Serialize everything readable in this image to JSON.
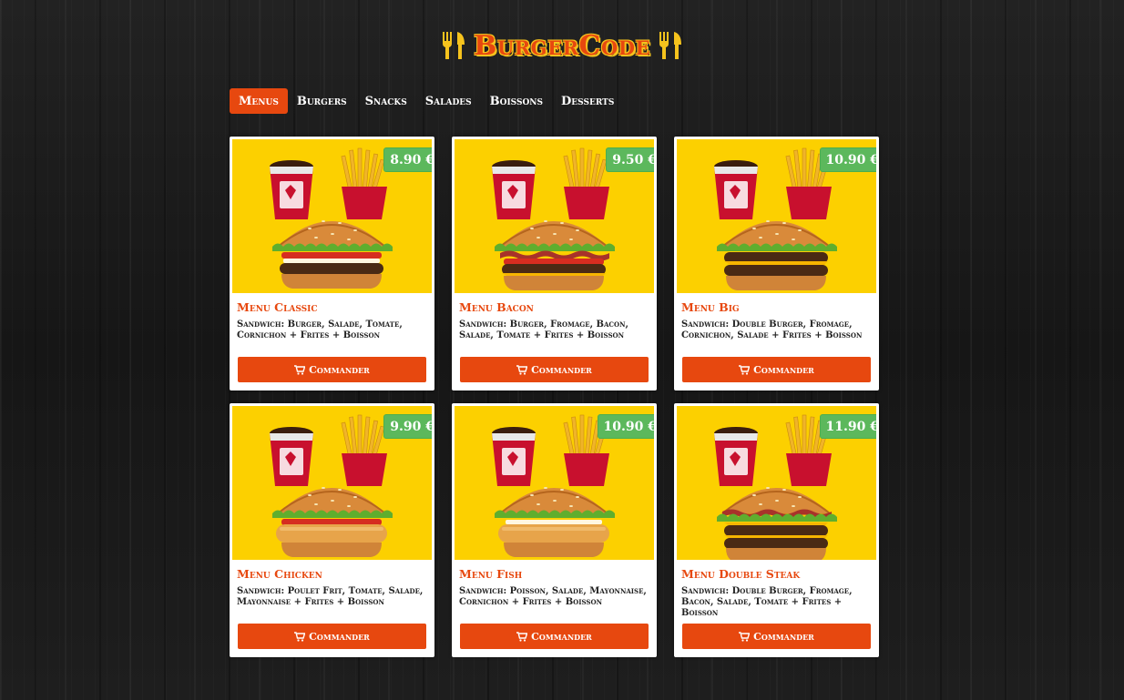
{
  "brand": {
    "name": "BurgerCode",
    "primary_color": "#e7480f",
    "accent_color": "#f6c31d",
    "price_color": "#5cb85c",
    "icon": "utensils-icon"
  },
  "nav": {
    "tabs": [
      {
        "label": "Menus",
        "active": true
      },
      {
        "label": "Burgers",
        "active": false
      },
      {
        "label": "Snacks",
        "active": false
      },
      {
        "label": "Salades",
        "active": false
      },
      {
        "label": "Boissons",
        "active": false
      },
      {
        "label": "Desserts",
        "active": false
      }
    ]
  },
  "items": [
    {
      "name": "Menu Classic",
      "price": "8.90 €",
      "description": "Sandwich: Burger, Salade, Tomate, Cornichon + Frites + Boisson",
      "button_label": "Commander",
      "burger": "classic"
    },
    {
      "name": "Menu Bacon",
      "price": "9.50 €",
      "description": "Sandwich: Burger, Fromage, Bacon, Salade, Tomate + Frites + Boisson",
      "button_label": "Commander",
      "burger": "bacon"
    },
    {
      "name": "Menu Big",
      "price": "10.90 €",
      "description": "Sandwich: Double Burger, Fromage, Cornichon, Salade + Frites + Boisson",
      "button_label": "Commander",
      "burger": "big"
    },
    {
      "name": "Menu Chicken",
      "price": "9.90 €",
      "description": "Sandwich: Poulet Frit, Tomate, Salade, Mayonnaise + Frites + Boisson",
      "button_label": "Commander",
      "burger": "chicken"
    },
    {
      "name": "Menu Fish",
      "price": "10.90 €",
      "description": "Sandwich: Poisson, Salade, Mayonnaise, Cornichon + Frites + Boisson",
      "button_label": "Commander",
      "burger": "fish"
    },
    {
      "name": "Menu Double Steak",
      "price": "11.90 €",
      "description": "Sandwich: Double Burger, Fromage, Bacon, Salade, Tomate + Frites + Boisson",
      "button_label": "Commander",
      "burger": "double"
    }
  ]
}
